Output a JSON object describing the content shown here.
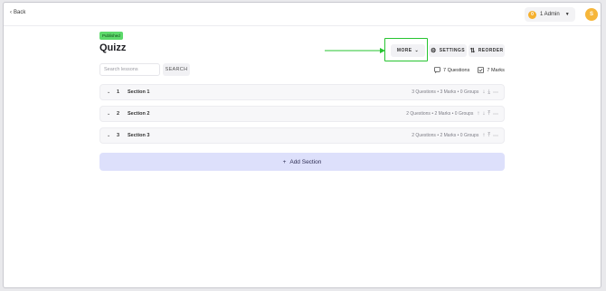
{
  "topbar": {
    "back_label": "Back",
    "admin_coin": "0",
    "admin_label": "1 Admin",
    "avatar_initial": "S"
  },
  "page": {
    "status_badge": "Published",
    "title": "Quizz"
  },
  "toolbar": {
    "more_label": "MORE",
    "settings_label": "SETTINGS",
    "reorder_label": "REORDER"
  },
  "search": {
    "placeholder": "Search lessons",
    "button_label": "SEARCH"
  },
  "stats": {
    "questions": "7 Questions",
    "marks": "7 Marks"
  },
  "sections": [
    {
      "number": "1",
      "title": "Section 1",
      "meta": "3 Questions • 3 Marks • 0 Groups"
    },
    {
      "number": "2",
      "title": "Section 2",
      "meta": "2 Questions • 2 Marks • 0 Groups"
    },
    {
      "number": "3",
      "title": "Section 3",
      "meta": "2 Questions • 2 Marks • 0 Groups"
    }
  ],
  "add_section_label": "Add Section",
  "colors": {
    "highlight": "#27c431",
    "badge": "#5dd96b",
    "add_section_bg": "#dde0fb",
    "avatar": "#f6b63a"
  },
  "icons": [
    "chevron-left-icon",
    "coin-icon",
    "chevron-down-icon",
    "gear-icon",
    "reorder-icon",
    "questions-icon",
    "marks-checkbox-icon",
    "arrow-up-icon",
    "arrow-down-icon",
    "collapse-up-icon",
    "more-dots-icon",
    "plus-icon"
  ]
}
